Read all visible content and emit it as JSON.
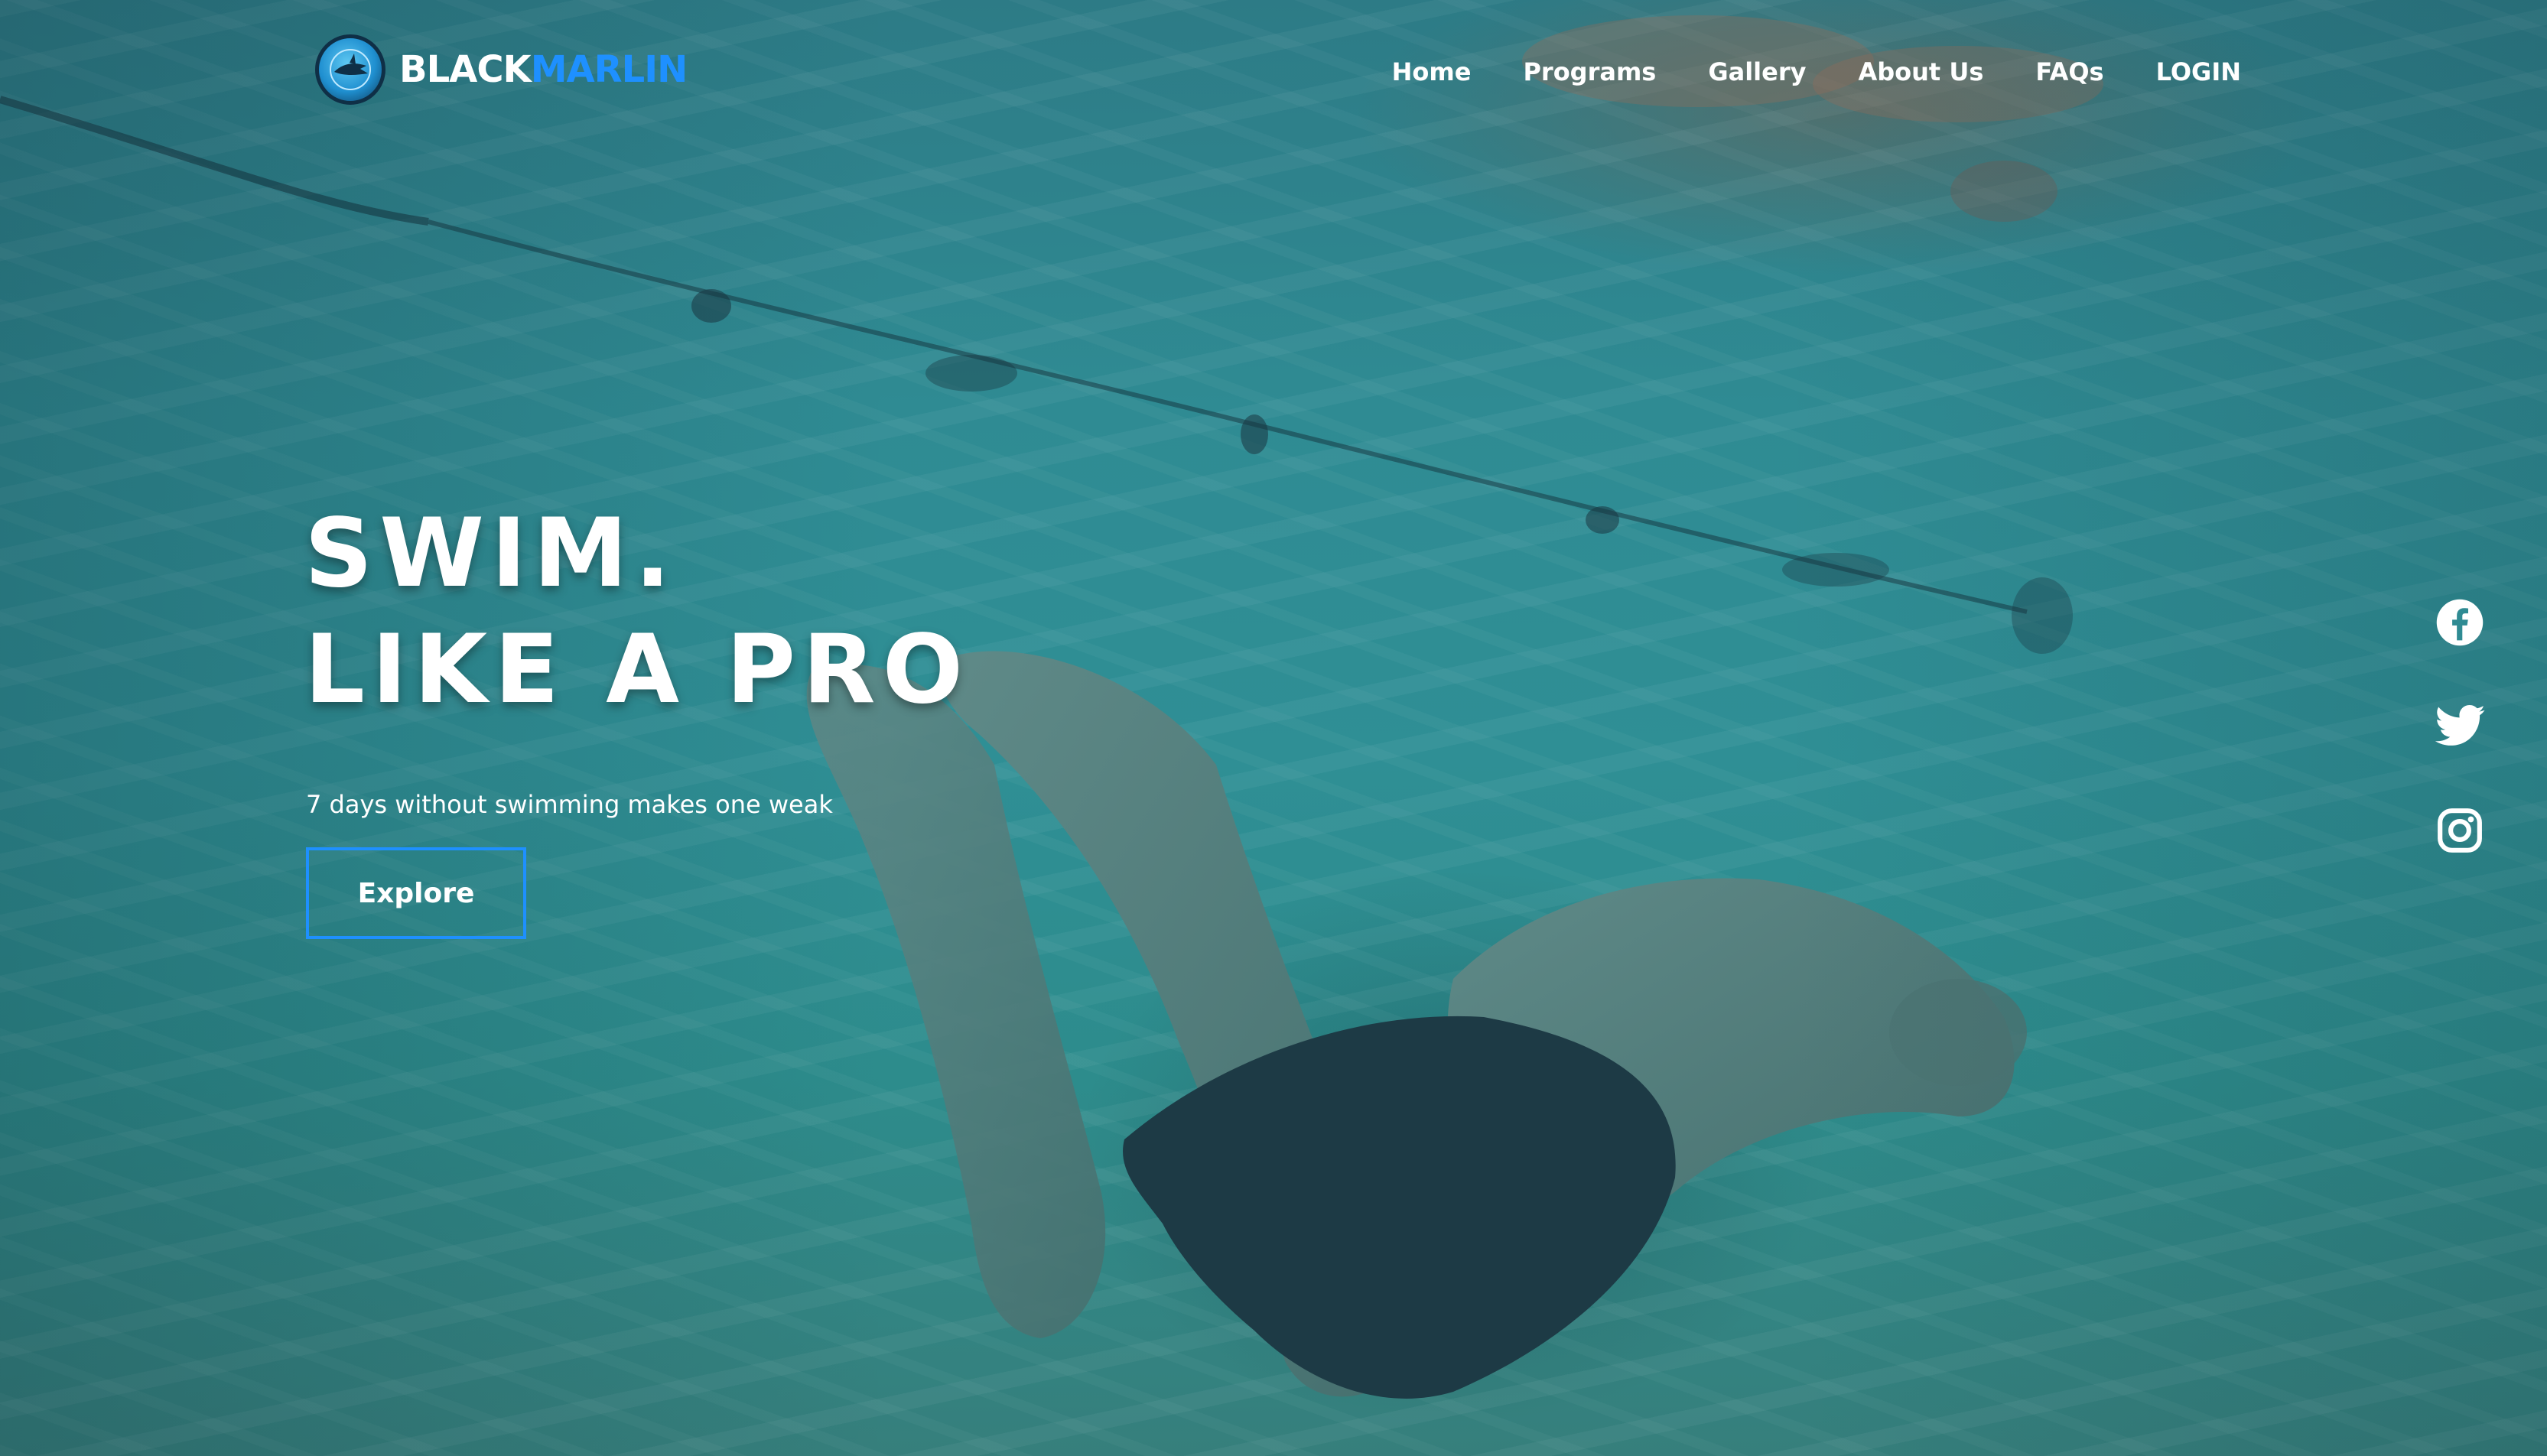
{
  "brand": {
    "name_part1": "BLACK",
    "name_part2": "MARLIN",
    "accent_color": "#1e90ff",
    "logo_icon": "marlin-logo-icon"
  },
  "nav": {
    "items": [
      {
        "label": "Home"
      },
      {
        "label": "Programs"
      },
      {
        "label": "Gallery"
      },
      {
        "label": "About Us"
      },
      {
        "label": "FAQs"
      },
      {
        "label": "LOGIN"
      }
    ]
  },
  "hero": {
    "headline_line1": "SWIM.",
    "headline_line2": "LIKE A PRO",
    "tagline": "7 days without swimming makes one weak",
    "cta_label": "Explore",
    "background": "underwater-swimmer-photo"
  },
  "social": {
    "icons": [
      "facebook-icon",
      "twitter-icon",
      "instagram-icon"
    ]
  }
}
